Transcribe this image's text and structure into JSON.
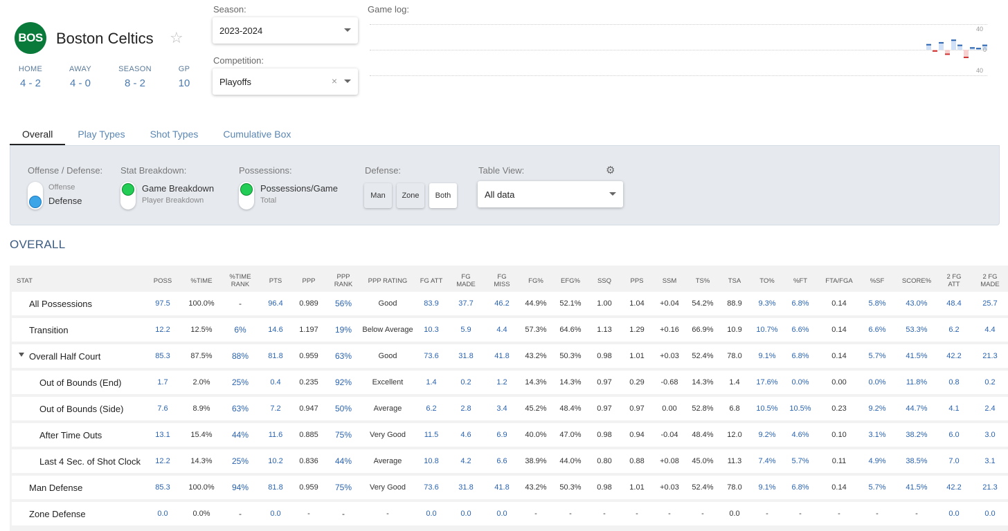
{
  "team": {
    "abbr": "BOS",
    "name": "Boston Celtics",
    "logo_color": "#0a7a3a"
  },
  "records": [
    {
      "label": "HOME",
      "value": "4 - 2"
    },
    {
      "label": "AWAY",
      "value": "4 - 0"
    },
    {
      "label": "SEASON",
      "value": "8 - 2"
    },
    {
      "label": "GP",
      "value": "10"
    }
  ],
  "season": {
    "label": "Season:",
    "value": "2023-2024"
  },
  "competition": {
    "label": "Competition:",
    "value": "Playoffs"
  },
  "gamelog": {
    "label": "Game log:",
    "axis": [
      "40",
      "0",
      "40"
    ],
    "bars": [
      9,
      -3,
      12,
      -8,
      16,
      8,
      -13,
      4,
      3,
      8
    ]
  },
  "tabs": [
    "Overall",
    "Play Types",
    "Shot Types",
    "Cumulative Box"
  ],
  "filters": {
    "offdef": {
      "label": "Offense / Defense:",
      "opt_top": "Offense",
      "opt_bottom": "Defense"
    },
    "stat": {
      "label": "Stat Breakdown:",
      "opt_top": "Game Breakdown",
      "opt_bottom": "Player Breakdown"
    },
    "poss": {
      "label": "Possessions:",
      "opt_top": "Possessions/Game",
      "opt_bottom": "Total"
    },
    "defense": {
      "label": "Defense:",
      "buttons": [
        "Man",
        "Zone",
        "Both"
      ]
    },
    "view": {
      "label": "Table View:",
      "value": "All data"
    }
  },
  "section_title": "OVERALL",
  "columns": [
    "STAT",
    "POSS",
    "%TIME",
    "%TIME RANK",
    "PTS",
    "PPP",
    "PPP RANK",
    "PPP RATING",
    "FG ATT",
    "FG MADE",
    "FG MISS",
    "FG%",
    "EFG%",
    "SSQ",
    "PPS",
    "SSM",
    "TS%",
    "TSA",
    "TO%",
    "%FT",
    "FTA/FGA",
    "%SF",
    "SCORE%",
    "2 FG ATT",
    "2 FG MADE"
  ],
  "rows": [
    {
      "name": "All Possessions",
      "indent": 1,
      "cells": [
        "97.5",
        "100.0%",
        "-",
        "96.4",
        "0.989",
        "56%",
        "Good",
        "83.9",
        "37.7",
        "46.2",
        "44.9%",
        "52.1%",
        "1.00",
        "1.04",
        "+0.04",
        "54.2%",
        "88.9",
        "9.3%",
        "6.8%",
        "0.14",
        "5.8%",
        "43.0%",
        "48.4",
        "25.7"
      ]
    },
    {
      "name": "Transition",
      "indent": 1,
      "cells": [
        "12.2",
        "12.5%",
        "6%",
        "14.6",
        "1.197",
        "19%",
        "Below Average",
        "10.3",
        "5.9",
        "4.4",
        "57.3%",
        "64.6%",
        "1.13",
        "1.29",
        "+0.16",
        "66.9%",
        "10.9",
        "10.7%",
        "6.6%",
        "0.14",
        "6.6%",
        "53.3%",
        "6.2",
        "4.4"
      ]
    },
    {
      "name": "Overall Half Court",
      "indent": 1,
      "expand": true,
      "cells": [
        "85.3",
        "87.5%",
        "88%",
        "81.8",
        "0.959",
        "63%",
        "Good",
        "73.6",
        "31.8",
        "41.8",
        "43.2%",
        "50.3%",
        "0.98",
        "1.01",
        "+0.03",
        "52.4%",
        "78.0",
        "9.1%",
        "6.8%",
        "0.14",
        "5.7%",
        "41.5%",
        "42.2",
        "21.3"
      ]
    },
    {
      "name": "Out of Bounds (End)",
      "indent": 2,
      "cells": [
        "1.7",
        "2.0%",
        "25%",
        "0.4",
        "0.235",
        "92%",
        "Excellent",
        "1.4",
        "0.2",
        "1.2",
        "14.3%",
        "14.3%",
        "0.97",
        "0.29",
        "-0.68",
        "14.3%",
        "1.4",
        "17.6%",
        "0.0%",
        "0.00",
        "0.0%",
        "11.8%",
        "0.8",
        "0.2"
      ]
    },
    {
      "name": "Out of Bounds (Side)",
      "indent": 2,
      "cells": [
        "7.6",
        "8.9%",
        "63%",
        "7.2",
        "0.947",
        "50%",
        "Average",
        "6.2",
        "2.8",
        "3.4",
        "45.2%",
        "48.4%",
        "0.97",
        "0.97",
        "0.00",
        "52.8%",
        "6.8",
        "10.5%",
        "10.5%",
        "0.23",
        "9.2%",
        "44.7%",
        "4.1",
        "2.4"
      ]
    },
    {
      "name": "After Time Outs",
      "indent": 2,
      "cells": [
        "13.1",
        "15.4%",
        "44%",
        "11.6",
        "0.885",
        "75%",
        "Very Good",
        "11.5",
        "4.6",
        "6.9",
        "40.0%",
        "47.0%",
        "0.98",
        "0.94",
        "-0.04",
        "48.4%",
        "12.0",
        "9.2%",
        "4.6%",
        "0.10",
        "3.1%",
        "38.2%",
        "6.0",
        "3.0"
      ]
    },
    {
      "name": "Last 4 Sec. of Shot Clock",
      "indent": 2,
      "cells": [
        "12.2",
        "14.3%",
        "25%",
        "10.2",
        "0.836",
        "44%",
        "Average",
        "10.8",
        "4.2",
        "6.6",
        "38.9%",
        "44.0%",
        "0.80",
        "0.88",
        "+0.08",
        "45.0%",
        "11.3",
        "7.4%",
        "5.7%",
        "0.11",
        "4.9%",
        "38.5%",
        "7.0",
        "3.1"
      ]
    },
    {
      "name": "Man Defense",
      "indent": 1,
      "cells": [
        "85.3",
        "100.0%",
        "94%",
        "81.8",
        "0.959",
        "75%",
        "Very Good",
        "73.6",
        "31.8",
        "41.8",
        "43.2%",
        "50.3%",
        "0.98",
        "1.01",
        "+0.03",
        "52.4%",
        "78.0",
        "9.1%",
        "6.8%",
        "0.14",
        "5.7%",
        "41.5%",
        "42.2",
        "21.3"
      ]
    },
    {
      "name": "Zone Defense",
      "indent": 1,
      "cells": [
        "0.0",
        "0.0%",
        "-",
        "0.0",
        "-",
        "-",
        "-",
        "0.0",
        "0.0",
        "0.0",
        "-",
        "-",
        "-",
        "-",
        "-",
        "-",
        "0.0",
        "-",
        "-",
        "-",
        "-",
        "-",
        "0.0",
        "0.0"
      ]
    }
  ]
}
